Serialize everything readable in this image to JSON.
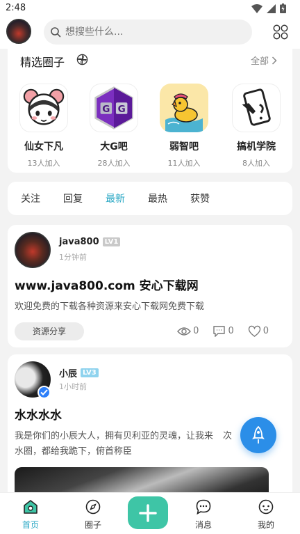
{
  "status_bar": {
    "time": "2:48"
  },
  "header": {
    "search_placeholder": "想搜些什么..."
  },
  "featured": {
    "title": "精选圈子",
    "all_label": "全部",
    "items": [
      {
        "name": "仙女下凡",
        "count": "13人加入"
      },
      {
        "name": "大G吧",
        "count": "28人加入"
      },
      {
        "name": "弱智吧",
        "count": "11人加入"
      },
      {
        "name": "搞机学院",
        "count": "8人加入"
      }
    ]
  },
  "feed_tabs": [
    {
      "label": "关注",
      "active": false
    },
    {
      "label": "回复",
      "active": false
    },
    {
      "label": "最新",
      "active": true
    },
    {
      "label": "最热",
      "active": false
    },
    {
      "label": "获赞",
      "active": false
    }
  ],
  "posts": [
    {
      "username": "java800",
      "level": "LV1",
      "time": "1分钟前",
      "title": "www.java800.com 安心下载网",
      "body": "欢迎免费的下载各种资源来安心下载网免费下载",
      "tag": "资源分享",
      "views": "0",
      "comments": "0",
      "likes": "0"
    },
    {
      "username": "小辰",
      "level": "LV3",
      "time": "1小时前",
      "title": "水水水水",
      "body_line1": "我是你们的小辰大人，拥有贝利亚的灵魂，让我来",
      "body_line1_tail": "次",
      "body_line2": "水圈，都给我跪下，俯首称臣"
    }
  ],
  "bottom_nav": {
    "home": "首页",
    "circles": "圈子",
    "messages": "消息",
    "mine": "我的"
  },
  "colors": {
    "accent": "#28a7c4",
    "add_button": "#3ec5a6",
    "fab": "#2b8ee8"
  }
}
